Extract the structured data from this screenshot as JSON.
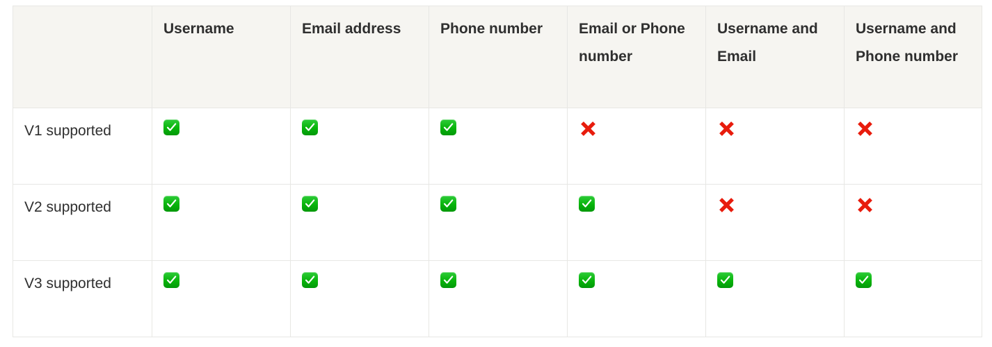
{
  "table": {
    "name": "username-support-matrix",
    "corner_header": "",
    "columns": [
      "Username",
      "Email address",
      "Phone number",
      "Email or Phone number",
      "Username and Email",
      "Username and Phone number"
    ],
    "rows": [
      {
        "label": "V1 supported",
        "cells": [
          "yes",
          "yes",
          "yes",
          "no",
          "no",
          "no"
        ]
      },
      {
        "label": "V2 supported",
        "cells": [
          "yes",
          "yes",
          "yes",
          "yes",
          "no",
          "no"
        ]
      },
      {
        "label": "V3 supported",
        "cells": [
          "yes",
          "yes",
          "yes",
          "yes",
          "yes",
          "yes"
        ]
      }
    ],
    "icons": {
      "yes": "check-mark-button-icon",
      "no": "cross-mark-icon"
    },
    "colors": {
      "header_background": "#f6f5f1",
      "body_background": "#ffffff",
      "border": "#e7e7e4",
      "text": "#2f2f2f",
      "yes_green": "#07b40a",
      "no_red": "#e81c0d"
    }
  }
}
